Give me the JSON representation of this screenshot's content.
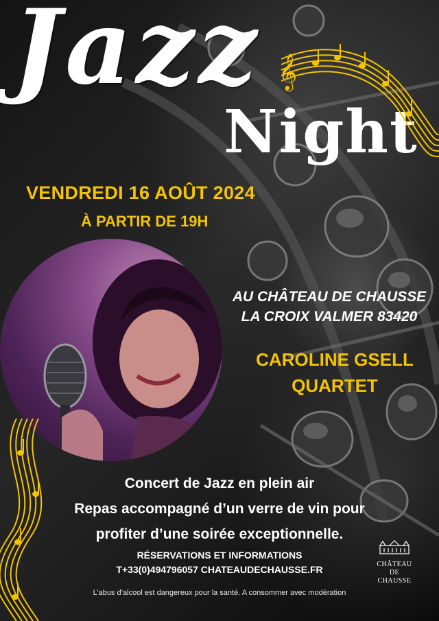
{
  "title": {
    "line1": "Jazz",
    "line2": "Night"
  },
  "event": {
    "date": "VENDREDI 16 AOÛT 2024",
    "time": "À PARTIR DE 19H"
  },
  "venue": {
    "line1": "AU CHÂTEAU DE CHAUSSE",
    "line2": "LA CROIX VALMER 83420"
  },
  "artist": {
    "line1": "CAROLINE GSELL",
    "line2": "QUARTET"
  },
  "description": {
    "line1": "Concert de Jazz en plein air",
    "line2": "Repas accompagné d’un verre de vin pour",
    "line3": "profiter d’une soirée exceptionnelle."
  },
  "reservations": {
    "heading": "RÉSERVATIONS ET INFORMATIONS",
    "contact": "T+33(0)494796057 CHATEAUDECHAUSSE.FR"
  },
  "disclaimer": "L’abus d’alcool est dangereux pour la santé. A consommer avec modération",
  "logo": {
    "line1": "CHÂTEAU",
    "line2": "DE",
    "line3": "CHAUSSE"
  },
  "colors": {
    "accent": "#f5c400",
    "text": "#ffffff",
    "background": "#0c0c0c",
    "photo_tint": "#8a4e8c"
  },
  "images": {
    "singer_photo": "singer-with-microphone",
    "background": "saxophone-keys",
    "decoration": "music-staff-notes"
  }
}
